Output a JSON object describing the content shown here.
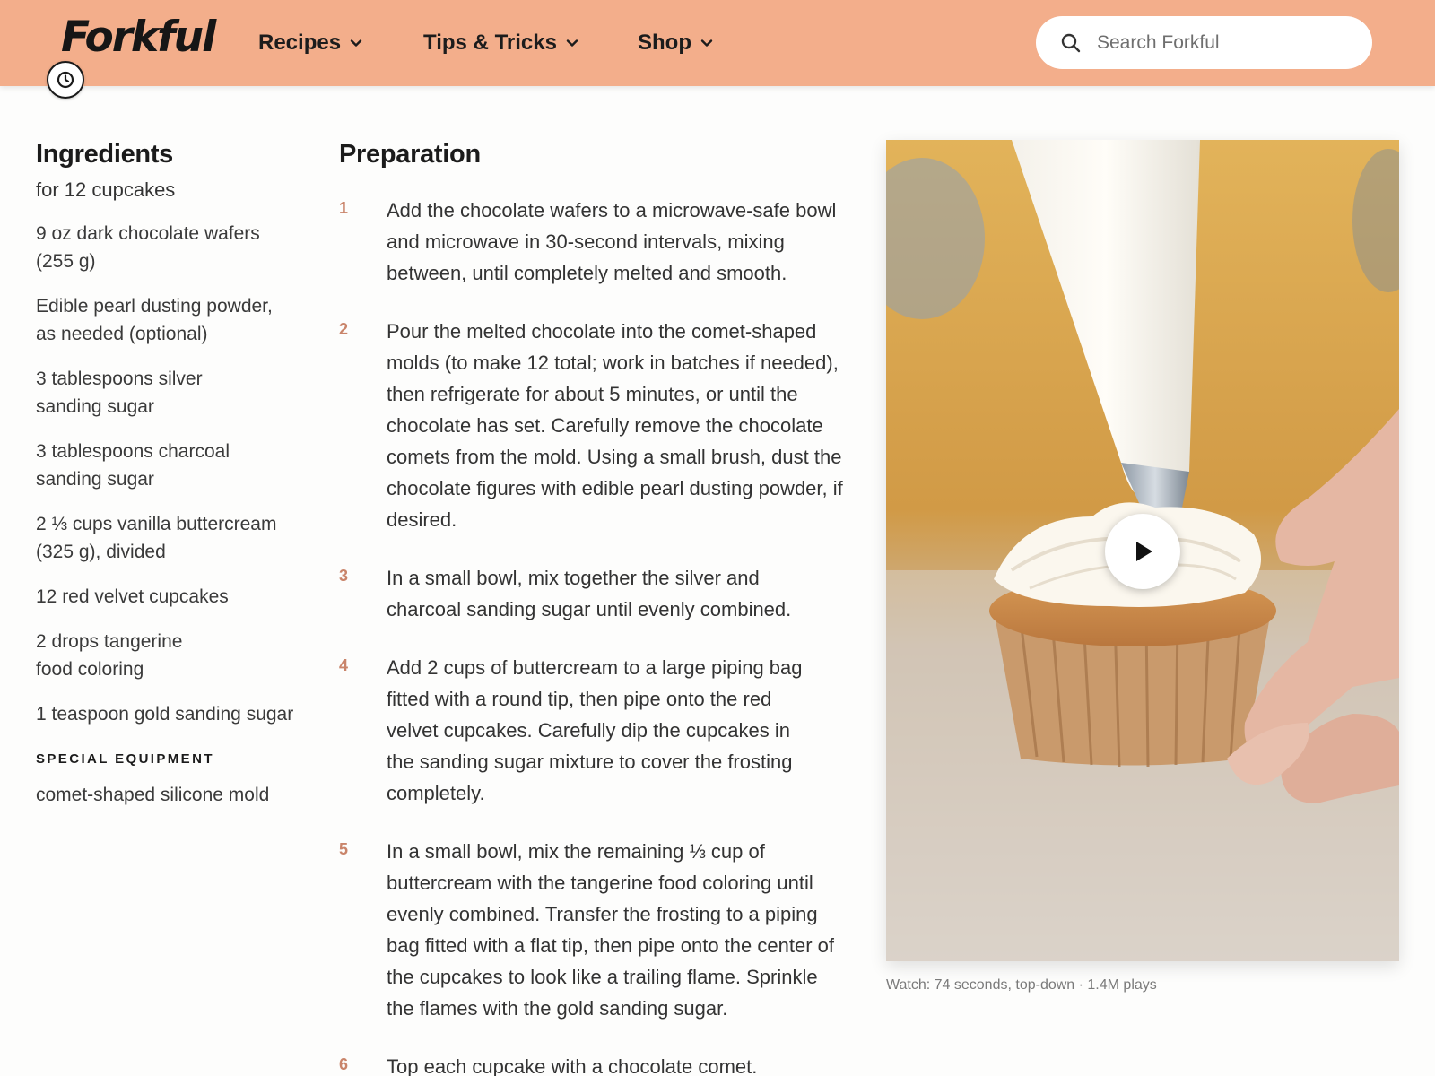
{
  "header": {
    "logo": "Forkful",
    "nav": [
      {
        "label": "Recipes"
      },
      {
        "label": "Tips & Tricks"
      },
      {
        "label": "Shop"
      }
    ],
    "search": {
      "placeholder": "Search Forkful",
      "value": ""
    },
    "colors": {
      "background": "#f3ae8b"
    }
  },
  "ingredients": {
    "title": "Ingredients",
    "subtitle": "for 12 cupcakes",
    "items": [
      "9 oz dark chocolate wafers (255 g)",
      "Edible pearl dusting powder, as needed (optional)",
      "3 tablespoons silver sanding sugar",
      "3 tablespoons charcoal sanding sugar",
      "2 ⅓ cups vanilla buttercream (325 g), divided",
      "12 red velvet cupcakes",
      "2 drops tangerine food coloring",
      "1 teaspoon gold sanding sugar"
    ],
    "equipment_label": "SPECIAL EQUIPMENT",
    "equipment": "comet-shaped silicone mold"
  },
  "preparation": {
    "title": "Preparation",
    "steps": [
      {
        "num": "1",
        "text": "Add the chocolate wafers to a microwave-safe bowl and microwave in 30-second intervals, mixing between, until completely melted and smooth."
      },
      {
        "num": "2",
        "text": "Pour the melted chocolate into the comet-shaped molds (to make 12 total; work in batches if needed), then refrigerate for about 5 minutes, or until the chocolate has set. Carefully remove the chocolate comets from the mold. Using a small brush, dust the chocolate figures with edible pearl dusting powder, if desired."
      },
      {
        "num": "3",
        "text": "In a small bowl, mix together the silver and charcoal sanding sugar until evenly combined."
      },
      {
        "num": "4",
        "text": "Add 2 cups of buttercream to a large piping bag fitted with a round tip, then pipe onto the red velvet cupcakes. Carefully dip the cupcakes in the sanding sugar mixture to cover the frosting completely."
      },
      {
        "num": "5",
        "text": "In a small bowl, mix the remaining ⅓ cup of buttercream with the tangerine food coloring until evenly combined. Transfer the frosting to a piping bag fitted with a flat tip, then pipe onto the center of the cupcakes to look like a trailing flame. Sprinkle the flames with the gold sanding sugar."
      },
      {
        "num": "6",
        "text": "Top each cupcake with a chocolate comet."
      }
    ],
    "number_color": "#c9846a"
  },
  "video": {
    "caption": "Watch: 74 seconds, top-down · 1.4M plays",
    "icons": {
      "play": "play-icon",
      "timer": "timer-icon",
      "search": "search-icon"
    }
  }
}
